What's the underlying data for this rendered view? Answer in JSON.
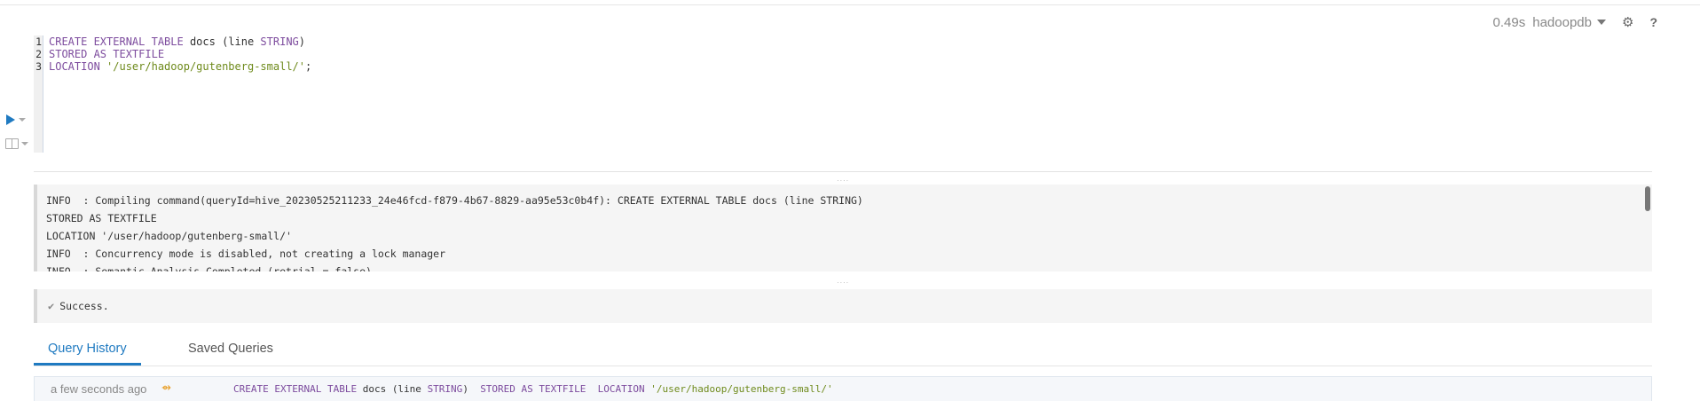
{
  "status": {
    "elapsed": "0.49s",
    "database": "hadoopdb",
    "settings_icon": "gear-icon",
    "help_icon": "help-icon",
    "help_glyph": "?"
  },
  "editor": {
    "line_numbers": [
      "1",
      "2",
      "3"
    ],
    "line1": {
      "k1": "CREATE EXTERNAL TABLE",
      "t1": " docs (line ",
      "k2": "STRING",
      "t2": ")"
    },
    "line2": {
      "k1": "STORED AS TEXTFILE"
    },
    "line3": {
      "k1": "LOCATION",
      "t1": " ",
      "s1": "'/user/hadoop/gutenberg-small/'",
      "t2": ";"
    }
  },
  "log": {
    "lines": [
      "INFO  : Compiling command(queryId=hive_20230525211233_24e46fcd-f879-4b67-8829-aa95e53c0b4f): CREATE EXTERNAL TABLE docs (line STRING)",
      "STORED AS TEXTFILE",
      "LOCATION '/user/hadoop/gutenberg-small/'",
      "INFO  : Concurrency mode is disabled, not creating a lock manager",
      "INFO  : Semantic Analysis Completed (retrial = false)"
    ]
  },
  "result": {
    "message": "Success."
  },
  "tabs": [
    {
      "label": "Query History",
      "active": true
    },
    {
      "label": "Saved Queries",
      "active": false
    }
  ],
  "history": {
    "time": "a few seconds ago",
    "query": {
      "k1": "CREATE EXTERNAL TABLE",
      "t1": " docs (line ",
      "k2": "STRING",
      "t2": ")  ",
      "k3": "STORED AS TEXTFILE",
      "t3": "  ",
      "k4": "LOCATION",
      "t4": " ",
      "s1": "'/user/hadoop/gutenberg-small/'"
    }
  },
  "colors": {
    "accent": "#1f7ac1",
    "keyword": "#7d4c9e",
    "string": "#6e8a1b",
    "pin": "#e8a02b"
  }
}
